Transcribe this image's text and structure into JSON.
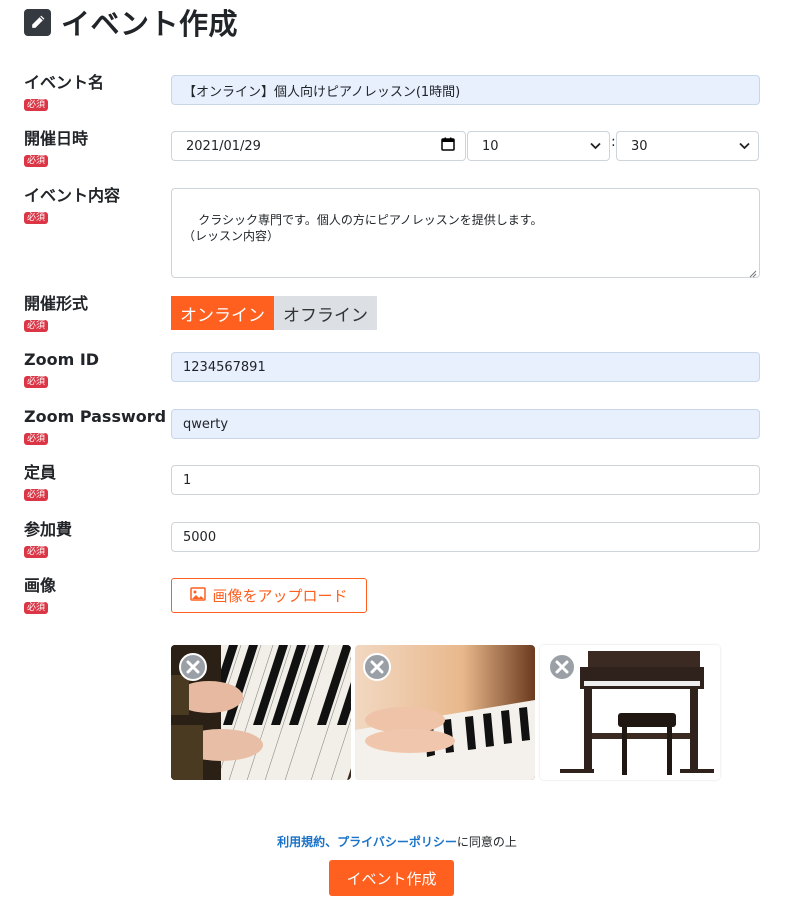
{
  "page": {
    "title": "イベント作成",
    "title_icon": "pencil-square-icon"
  },
  "required_badge": "必須",
  "form": {
    "event_name": {
      "label": "イベント名",
      "value": "【オンライン】個人向けピアノレッスン(1時間)"
    },
    "datetime": {
      "label": "開催日時",
      "date": "2021/01/29",
      "hour": "10",
      "separator": ":",
      "minute": "30"
    },
    "description": {
      "label": "イベント内容",
      "value": "クラシック専門です。個人の方にピアノレッスンを提供します。\n（レッスン内容）"
    },
    "format": {
      "label": "開催形式",
      "options": [
        "オンライン",
        "オフライン"
      ],
      "selected": "オンライン"
    },
    "zoom_id": {
      "label": "Zoom ID",
      "value": "1234567891"
    },
    "zoom_password": {
      "label": "Zoom Password",
      "value": "qwerty"
    },
    "capacity": {
      "label": "定員",
      "value": "1"
    },
    "fee": {
      "label": "参加費",
      "value": "5000"
    },
    "image": {
      "label": "画像",
      "upload_button": "画像をアップロード"
    }
  },
  "images": [
    {
      "name": "piano-hands-closeup"
    },
    {
      "name": "piano-hands-blurred"
    },
    {
      "name": "digital-piano-with-bench"
    }
  ],
  "agreement": {
    "terms": "利用規約",
    "sep": "、",
    "privacy": "プライバシーポリシー",
    "suffix": "に同意の上"
  },
  "submit_label": "イベント作成",
  "colors": {
    "accent": "#ff5f1f",
    "required": "#dc3545",
    "link": "#1a73c8",
    "autofill_bg": "#e8f0fe"
  }
}
